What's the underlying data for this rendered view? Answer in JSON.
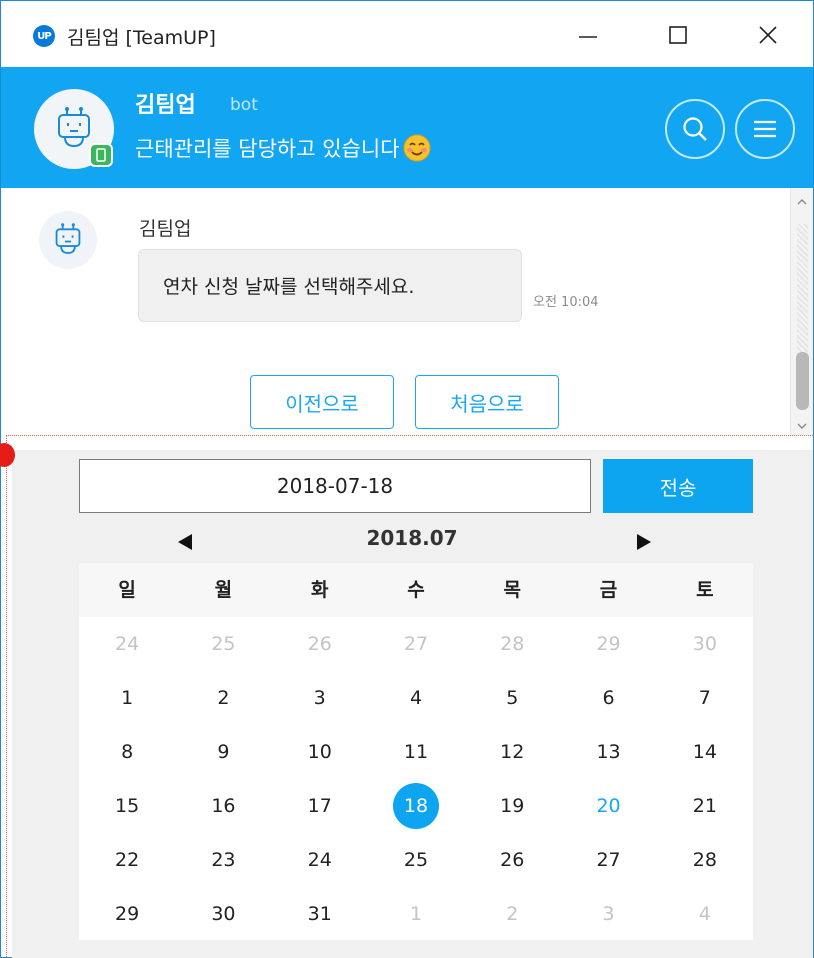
{
  "window": {
    "title": "김팀업 [TeamUP]",
    "logo_text": "UP"
  },
  "header": {
    "bot_name": "김팀업",
    "bot_tag": "bot",
    "status": "근태관리를 담당하고 있습니다"
  },
  "message": {
    "sender": "김팀업",
    "text": "연차 신청 날짜를 선택해주세요.",
    "time": "오전 10:04"
  },
  "actions": {
    "prev_label": "이전으로",
    "first_label": "처음으로"
  },
  "picker": {
    "date_value": "2018-07-18",
    "send_label": "전송",
    "month_label": "2018.07",
    "weekdays": [
      "일",
      "월",
      "화",
      "수",
      "목",
      "금",
      "토"
    ],
    "weeks": [
      [
        "24",
        "25",
        "26",
        "27",
        "28",
        "29",
        "30"
      ],
      [
        "1",
        "2",
        "3",
        "4",
        "5",
        "6",
        "7"
      ],
      [
        "8",
        "9",
        "10",
        "11",
        "12",
        "13",
        "14"
      ],
      [
        "15",
        "16",
        "17",
        "18",
        "19",
        "20",
        "21"
      ],
      [
        "22",
        "23",
        "24",
        "25",
        "26",
        "27",
        "28"
      ],
      [
        "29",
        "30",
        "31",
        "1",
        "2",
        "3",
        "4"
      ]
    ],
    "selected_day": "18",
    "today_day": "20"
  },
  "colors": {
    "accent": "#12a6f2",
    "selected": "#0da5f0",
    "muted": "#c4c4c4",
    "badge": "#3cb65b"
  },
  "icons": {
    "logo": "teamup-logo-icon",
    "minimize": "minimize-icon",
    "maximize": "maximize-icon",
    "close": "close-icon",
    "search": "search-icon",
    "menu": "hamburger-menu-icon",
    "bot": "robot-icon",
    "mobile": "mobile-device-icon",
    "emoji": "smiling-face-icon",
    "prev_month": "triangle-left-icon",
    "next_month": "triangle-right-icon"
  }
}
